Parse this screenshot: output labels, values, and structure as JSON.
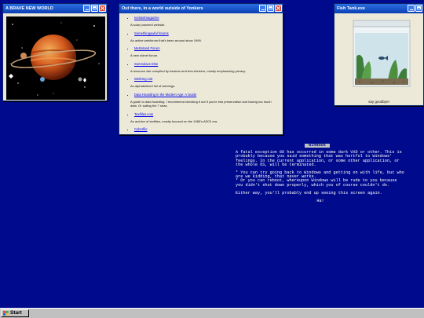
{
  "windows": {
    "planet": {
      "title": "A BRAVE NEW WORLD"
    },
    "web": {
      "title": "Out there, in a world outside of Yonkers",
      "links": [
        {
          "label": "Icelandmagazine",
          "desc": "A solar powered website."
        },
        {
          "label": "Somethingawful forums",
          "desc": "An active webforum that's been around since 1999."
        },
        {
          "label": "Metzeland Forum",
          "desc": "A new oldnet forum."
        },
        {
          "label": "Somnolace Else",
          "desc": "A resource site compiled by hackers and free-thinkers, mostly emphasizing privacy."
        },
        {
          "label": "Webring List",
          "desc": "An alphabetized list of webrings."
        },
        {
          "label": "Data Hoarding in the Modern Age: A Guide",
          "desc": "A guide to data hoarding. I recommend checking it out if you're into preservation and having too much data. Or sailing the 7 seas."
        },
        {
          "label": "Textfiles.com",
          "desc": "An archive of textfiles, mostly focused on the 1980's ASCII era."
        },
        {
          "label": "Cyberfile",
          "desc": ""
        }
      ]
    },
    "fish": {
      "title": "Fish Tank.exe",
      "caption": "say goodbye!"
    }
  },
  "bsod": {
    "header": "Windows",
    "p1": "A fatal exception 0D has occurred in some dark VXD or other. This is probably because you said something that was hurtful to Windows' feelings. In the current application, or some other application, or the whole OS, will be terminated.",
    "b1": "* You can try going back to Windows and getting on with life, but who are we kidding, that never works.",
    "b2": "* Or you can reboot, whereupon Windows will be rude to you because you didn't shut down properly, which you of course couldn't do.",
    "p2": "Either way, you'll probably end up seeing this screen again.",
    "ok": "Ha!"
  },
  "taskbar": {
    "start_label": "Start"
  },
  "colors": {
    "desktop": "#000a8c",
    "titlebar": "#0a3fb5",
    "window": "#ece9d8",
    "taskbar": "#c0c0c0"
  }
}
